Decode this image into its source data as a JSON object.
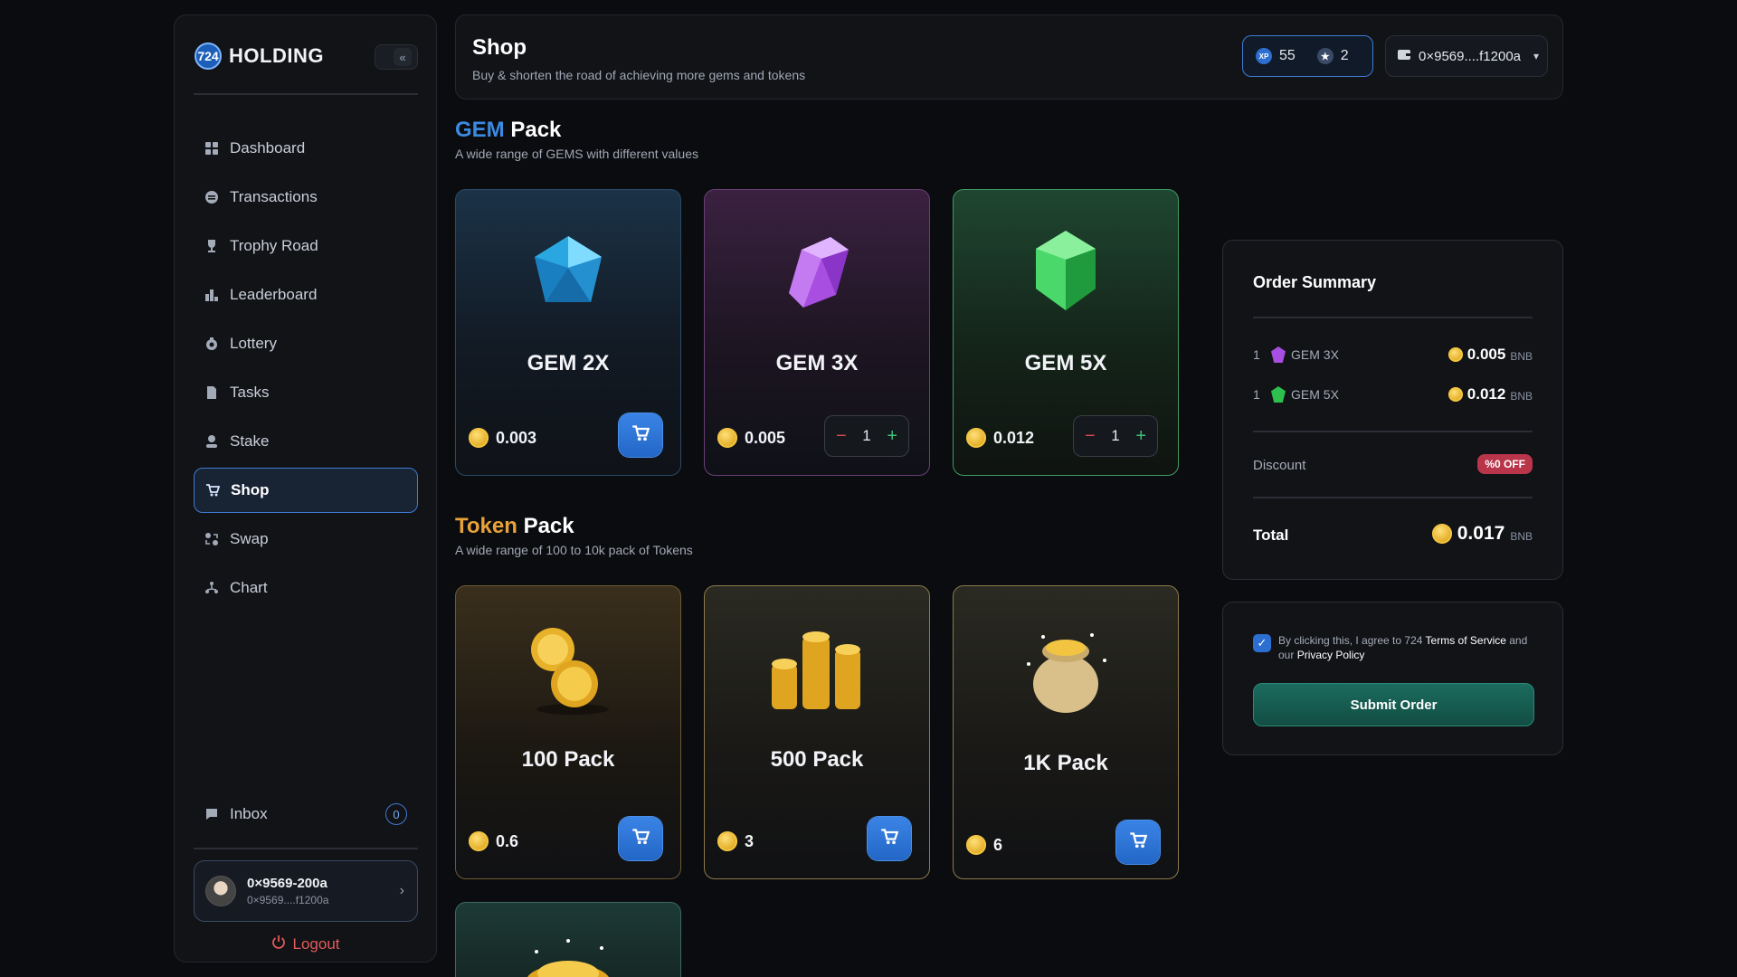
{
  "brand": {
    "logo_mark": "724",
    "name": "HOLDING"
  },
  "sidebar": {
    "collapse_icon": "«",
    "items": [
      {
        "label": "Dashboard",
        "icon": "grid-icon"
      },
      {
        "label": "Transactions",
        "icon": "transactions-icon"
      },
      {
        "label": "Trophy Road",
        "icon": "trophy-icon"
      },
      {
        "label": "Leaderboard",
        "icon": "leaderboard-icon"
      },
      {
        "label": "Lottery",
        "icon": "lottery-icon"
      },
      {
        "label": "Tasks",
        "icon": "file-icon"
      },
      {
        "label": "Stake",
        "icon": "stake-icon"
      },
      {
        "label": "Shop",
        "icon": "cart-icon",
        "active": true
      },
      {
        "label": "Swap",
        "icon": "swap-icon"
      },
      {
        "label": "Chart",
        "icon": "chart-icon"
      }
    ],
    "inbox": {
      "label": "Inbox",
      "count": "0"
    },
    "profile": {
      "name": "0×9569-200a",
      "address": "0×9569....f1200a"
    },
    "logout": "Logout"
  },
  "header": {
    "title": "Shop",
    "subtitle": "Buy & shorten the road of achieving more gems and tokens",
    "xp": "55",
    "stars": "2",
    "wallet": "0×9569....f1200a"
  },
  "gem_section": {
    "title_accent": "GEM",
    "title_rest": "Pack",
    "subtitle": "A wide range of GEMS with different values"
  },
  "gems": [
    {
      "name": "GEM 2X",
      "price": "0.003"
    },
    {
      "name": "GEM 3X",
      "price": "0.005",
      "qty": "1"
    },
    {
      "name": "GEM 5X",
      "price": "0.012",
      "qty": "1"
    }
  ],
  "token_section": {
    "title_accent": "Token",
    "title_rest": "Pack",
    "subtitle": "A wide range of 100 to 10k pack of Tokens"
  },
  "tokens": [
    {
      "name": "100 Pack",
      "price": "0.6"
    },
    {
      "name": "500 Pack",
      "price": "3"
    },
    {
      "name": "1K Pack",
      "price": "6"
    }
  ],
  "summary": {
    "title": "Order Summary",
    "items": [
      {
        "qty": "1",
        "name": "GEM 3X",
        "amount": "0.005",
        "unit": "BNB"
      },
      {
        "qty": "1",
        "name": "GEM 5X",
        "amount": "0.012",
        "unit": "BNB"
      }
    ],
    "discount_label": "Discount",
    "discount_badge": "%0 OFF",
    "total_label": "Total",
    "total": "0.017",
    "total_unit": "BNB"
  },
  "terms": {
    "prefix": "By clicking this, I agree to 724",
    "tos": "Terms of Service",
    "middle": "and our",
    "privacy": "Privacy Policy"
  },
  "submit_label": "Submit Order",
  "colors": {
    "accent_blue": "#3b8ae0",
    "accent_orange": "#e8a23a",
    "submit_green": "#1b6b5e"
  }
}
